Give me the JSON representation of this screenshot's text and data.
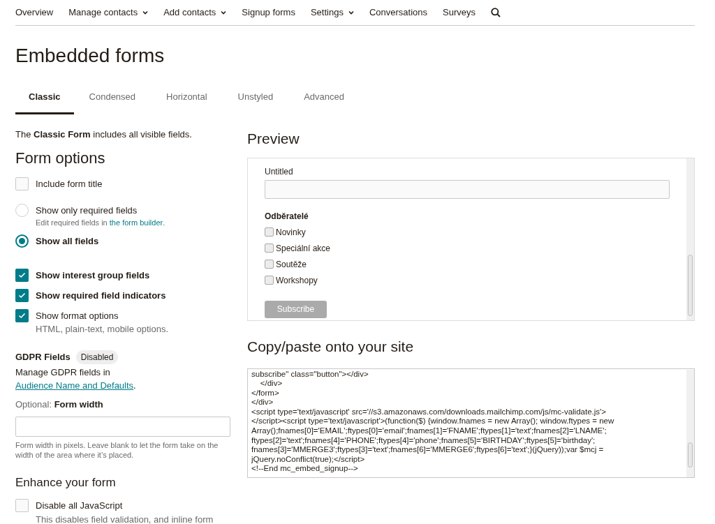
{
  "nav": [
    {
      "label": "Overview",
      "dropdown": false
    },
    {
      "label": "Manage contacts",
      "dropdown": true
    },
    {
      "label": "Add contacts",
      "dropdown": true
    },
    {
      "label": "Signup forms",
      "dropdown": false
    },
    {
      "label": "Settings",
      "dropdown": true
    },
    {
      "label": "Conversations",
      "dropdown": false
    },
    {
      "label": "Surveys",
      "dropdown": false
    }
  ],
  "page_title": "Embedded forms",
  "tabs": [
    {
      "label": "Classic",
      "selected": true
    },
    {
      "label": "Condensed",
      "selected": false
    },
    {
      "label": "Horizontal",
      "selected": false
    },
    {
      "label": "Unstyled",
      "selected": false
    },
    {
      "label": "Advanced",
      "selected": false
    }
  ],
  "intro": "The **Classic Form** includes all visible fields.",
  "form_options": {
    "title": "Form options",
    "items": [
      {
        "kind": "checkbox",
        "label": "Include form title",
        "checked": false,
        "strong": false
      },
      {
        "kind": "radio",
        "label": "Show only required fields",
        "selected": false,
        "strong": false,
        "hint": "Edit required fields in",
        "hint_link": "the form builder",
        "hint_end": "."
      },
      {
        "kind": "radio",
        "label": "Show all fields",
        "selected": true,
        "strong": true
      },
      {
        "kind": "checkbox",
        "label": "Show interest group fields",
        "checked": true,
        "strong": true
      },
      {
        "kind": "checkbox",
        "label": "Show required field indicators",
        "checked": true,
        "strong": true
      },
      {
        "kind": "checkbox",
        "label": "Show format options",
        "checked": true,
        "strong": false,
        "hint": "HTML, plain-text, mobile options."
      }
    ]
  },
  "gdpr": {
    "title": "GDPR Fields",
    "badge": "Disabled",
    "text": "Manage GDPR fields in",
    "link": "Audience Name and Defaults",
    "end": "."
  },
  "form_width": {
    "label": "Optional: **Form width**",
    "help": "Form width in pixels. Leave blank to let the form take on the width of the area where it’s placed."
  },
  "enhance": {
    "title": "Enhance your form",
    "items": [
      {
        "label": "Disable all JavaScript",
        "checked": false,
        "hint": "This disables field validation, and inline form"
      }
    ]
  },
  "preview": {
    "title": "Preview",
    "field_label": "Untitled",
    "group_title": "Odběratelé",
    "groups": [
      {
        "label": "Novinky",
        "checked": false
      },
      {
        "label": "Speciální akce",
        "checked": false
      },
      {
        "label": "Soutěže",
        "checked": false
      },
      {
        "label": "Workshopy",
        "checked": false
      }
    ],
    "button": "Subscribe"
  },
  "code": {
    "title": "Copy/paste onto your site",
    "lines": [
      "subscribe\" class=\"button\"></div>",
      "    </div>",
      "</form>",
      "</div>",
      "<script type='text/javascript' src='//s3.amazonaws.com/downloads.mailchimp.com/js/mc-validate.js'>",
      "</script><script type='text/javascript'>(function($) {window.fnames = new Array(); window.ftypes = new",
      "Array();fnames[0]='EMAIL';ftypes[0]='email';fnames[1]='FNAME';ftypes[1]='text';fnames[2]='LNAME';",
      "ftypes[2]='text';fnames[4]='PHONE';ftypes[4]='phone';fnames[5]='BIRTHDAY';ftypes[5]='birthday';",
      "fnames[3]='MMERGE3';ftypes[3]='text';fnames[6]='MMERGE6';ftypes[6]='text';}(jQuery));var $mcj =",
      "jQuery.noConflict(true);</script>",
      "<!--End mc_embed_signup-->"
    ]
  }
}
